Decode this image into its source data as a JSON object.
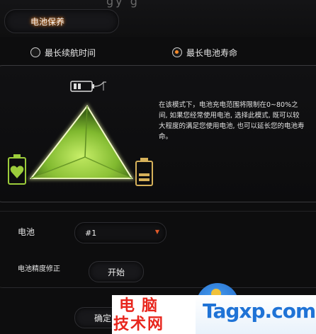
{
  "tab": {
    "label": "电池保养"
  },
  "modes": [
    {
      "label": "最长续航时间",
      "selected": false
    },
    {
      "label": "最长电池寿命",
      "selected": true
    }
  ],
  "description": "在该模式下，电池充电范围将限制在0~80%之间, 如果您经常使用电池, 选择此模式, 既可以较大程度的满足您使用电池, 也可以延长您的电池寿命。",
  "battery": {
    "label": "电池",
    "selected": "#1"
  },
  "calibration": {
    "label": "电池精度修正",
    "button": "开始"
  },
  "footer": {
    "confirm": "确定"
  },
  "watermark": {
    "line1": "电脑",
    "line2": "技术网",
    "site": "Tagxp.com"
  },
  "colors": {
    "accent": "#ff8c2a",
    "triangle_green": "#8ec63f",
    "heart_green": "#9ccc3b",
    "battery_gold": "#d6b15a"
  }
}
